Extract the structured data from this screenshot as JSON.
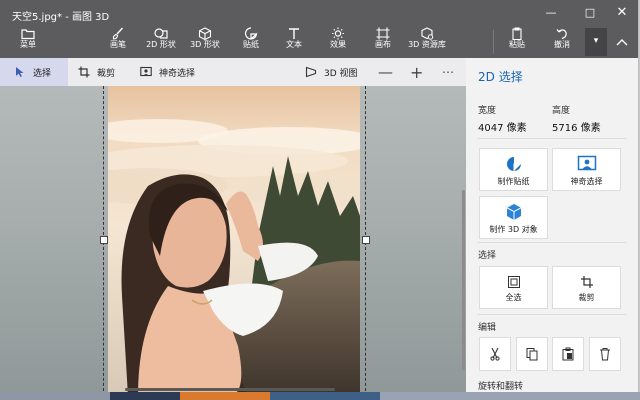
{
  "window": {
    "title": "天空5.jpg* - 画图 3D"
  },
  "ribbon": {
    "menu": "菜单",
    "tools": [
      "画笔",
      "2D 形状",
      "3D 形状",
      "贴纸",
      "文本",
      "效果",
      "画布",
      "3D 资源库"
    ],
    "paste": "粘贴",
    "undo": "撤消"
  },
  "toolbar": {
    "select": "选择",
    "crop": "裁剪",
    "magic_select": "神奇选择",
    "view3d": "3D 视图"
  },
  "panel": {
    "title": "2D 选择",
    "width_label": "宽度",
    "width_value": "4047 像素",
    "height_label": "高度",
    "height_value": "5716 像素",
    "make_sticker": "制作贴纸",
    "magic_select": "神奇选择",
    "make_3d": "制作 3D 对象",
    "select_section": "选择",
    "select_all": "全选",
    "crop": "裁剪",
    "edit_section": "编辑",
    "rotate_section": "旋转和翻转"
  },
  "colors": {
    "title_bar": "#5c5c5f",
    "accent": "#1a64b5",
    "active_tool": "#d6d8ee",
    "icon_blue": "#1f73c7"
  }
}
